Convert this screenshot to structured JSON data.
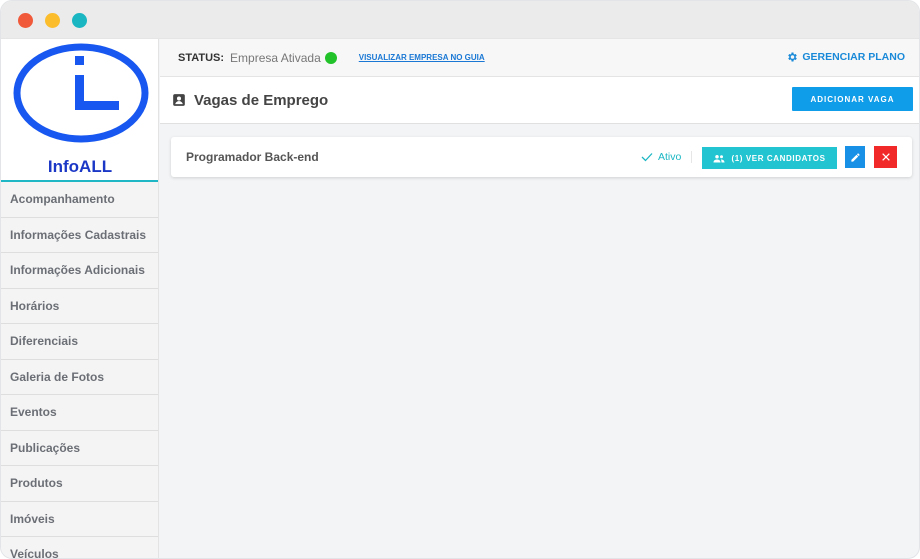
{
  "colors": {
    "brand": "#1b37c6",
    "accent": "#0f9ce8",
    "teal": "#21c4d0",
    "danger": "#f12a29",
    "status_ok": "#22c32a"
  },
  "window": {
    "controls": [
      "close",
      "minimize",
      "maximize"
    ]
  },
  "brand": {
    "name": "InfoALL",
    "logo_icon": "info-logo"
  },
  "sidebar": {
    "items": [
      {
        "label": "Acompanhamento"
      },
      {
        "label": "Informações Cadastrais"
      },
      {
        "label": "Informações Adicionais"
      },
      {
        "label": "Horários"
      },
      {
        "label": "Diferenciais"
      },
      {
        "label": "Galeria de Fotos"
      },
      {
        "label": "Eventos"
      },
      {
        "label": "Publicações"
      },
      {
        "label": "Produtos"
      },
      {
        "label": "Imóveis"
      },
      {
        "label": "Veículos"
      }
    ]
  },
  "statusbar": {
    "status_key": "STATUS:",
    "status_value": "Empresa Ativada",
    "view_link": "VISUALIZAR EMPRESA NO GUIA",
    "manage_label": "GERENCIAR PLANO",
    "manage_icon": "gear-icon"
  },
  "header": {
    "title": "Vagas de Emprego",
    "icon": "contact-card-icon",
    "add_button": "ADICIONAR VAGA"
  },
  "jobs": [
    {
      "title": "Programador Back-end",
      "state": "Ativo",
      "candidates_button": "(1) VER CANDIDATOS"
    }
  ]
}
